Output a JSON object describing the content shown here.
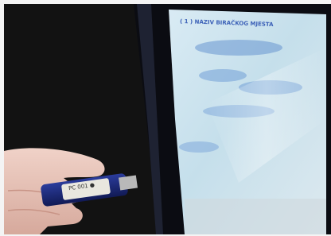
{
  "photo": {
    "subject": "usb-drive-being-inserted-into-tablet-edge",
    "screen_heading": "( 1 ) NAZIV BIRAČKOG MJESTA",
    "usb_label": "PC 001 ●"
  },
  "colors": {
    "background_dark": "#121212",
    "tablet_bezel": "#0b0c12",
    "screen_light": "#cde3ee",
    "screen_blue_text": "#3d62b8",
    "usb_body": "#1c2a7a",
    "usb_label": "#e9e7df",
    "skin": "#e6c3b8",
    "white_surface": "#f4f4f4"
  }
}
